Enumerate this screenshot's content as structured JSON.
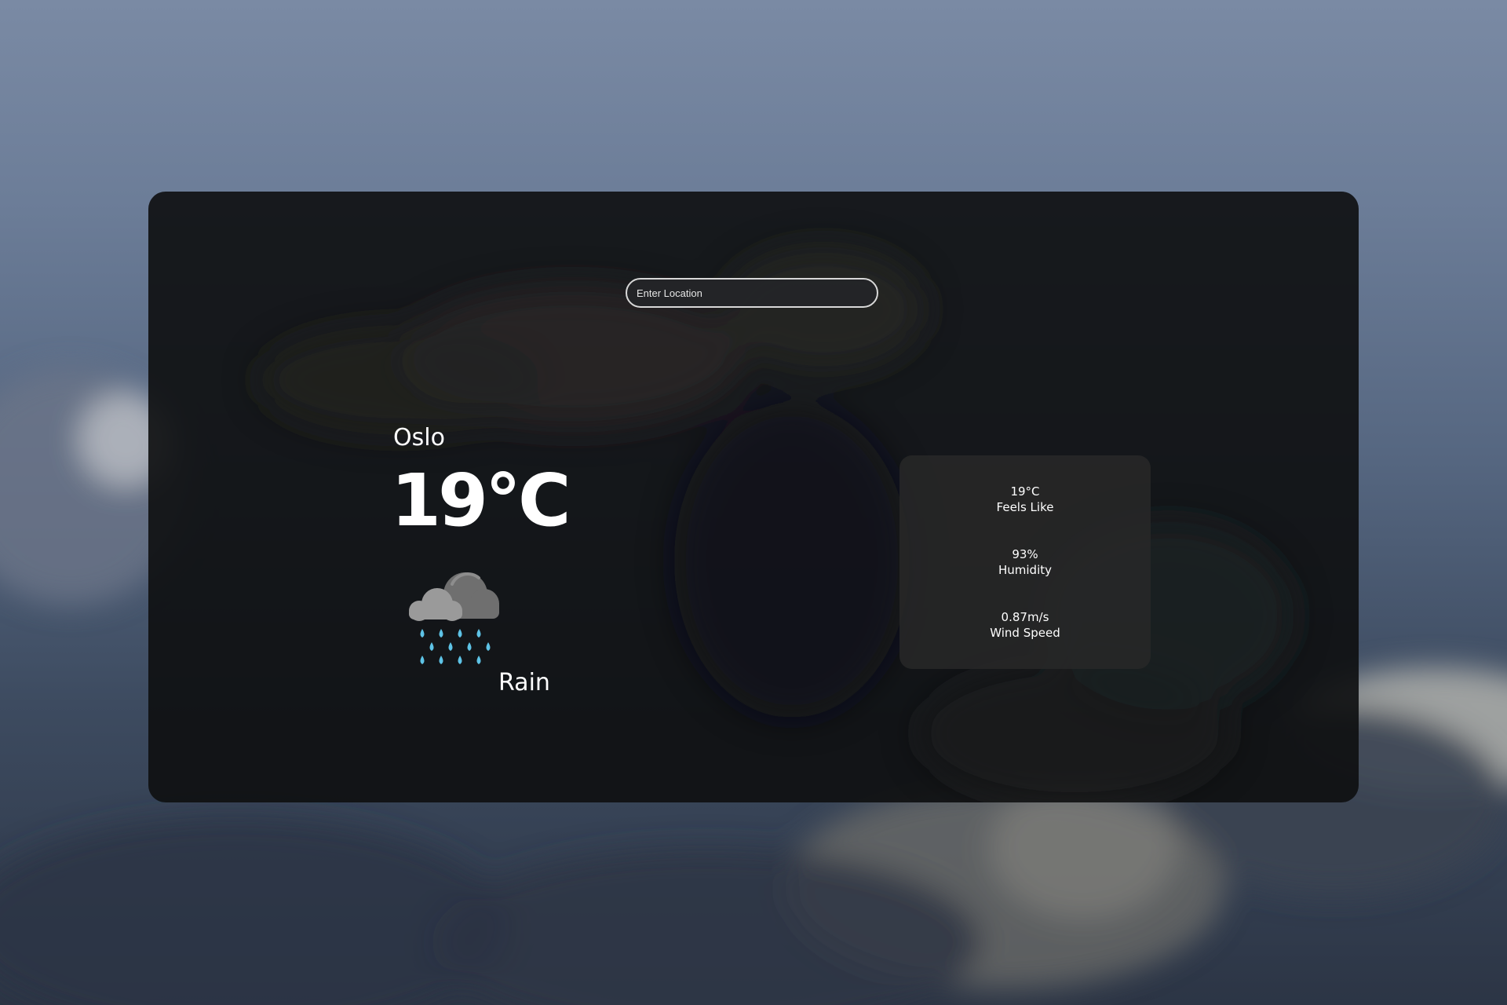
{
  "search": {
    "placeholder": "Enter Location"
  },
  "weather": {
    "city": "Oslo",
    "temperature": "19°C",
    "condition": "Rain",
    "icon": "rain-cloud-icon"
  },
  "details": [
    {
      "value": "19°C",
      "label": "Feels Like"
    },
    {
      "value": "93%",
      "label": "Humidity"
    },
    {
      "value": "0.87m/s",
      "label": "Wind Speed"
    }
  ],
  "colors": {
    "panel": "#0e0f11",
    "details_card": "#282828",
    "rain_drop": "#5ec3e6",
    "text": "#ffffff"
  }
}
